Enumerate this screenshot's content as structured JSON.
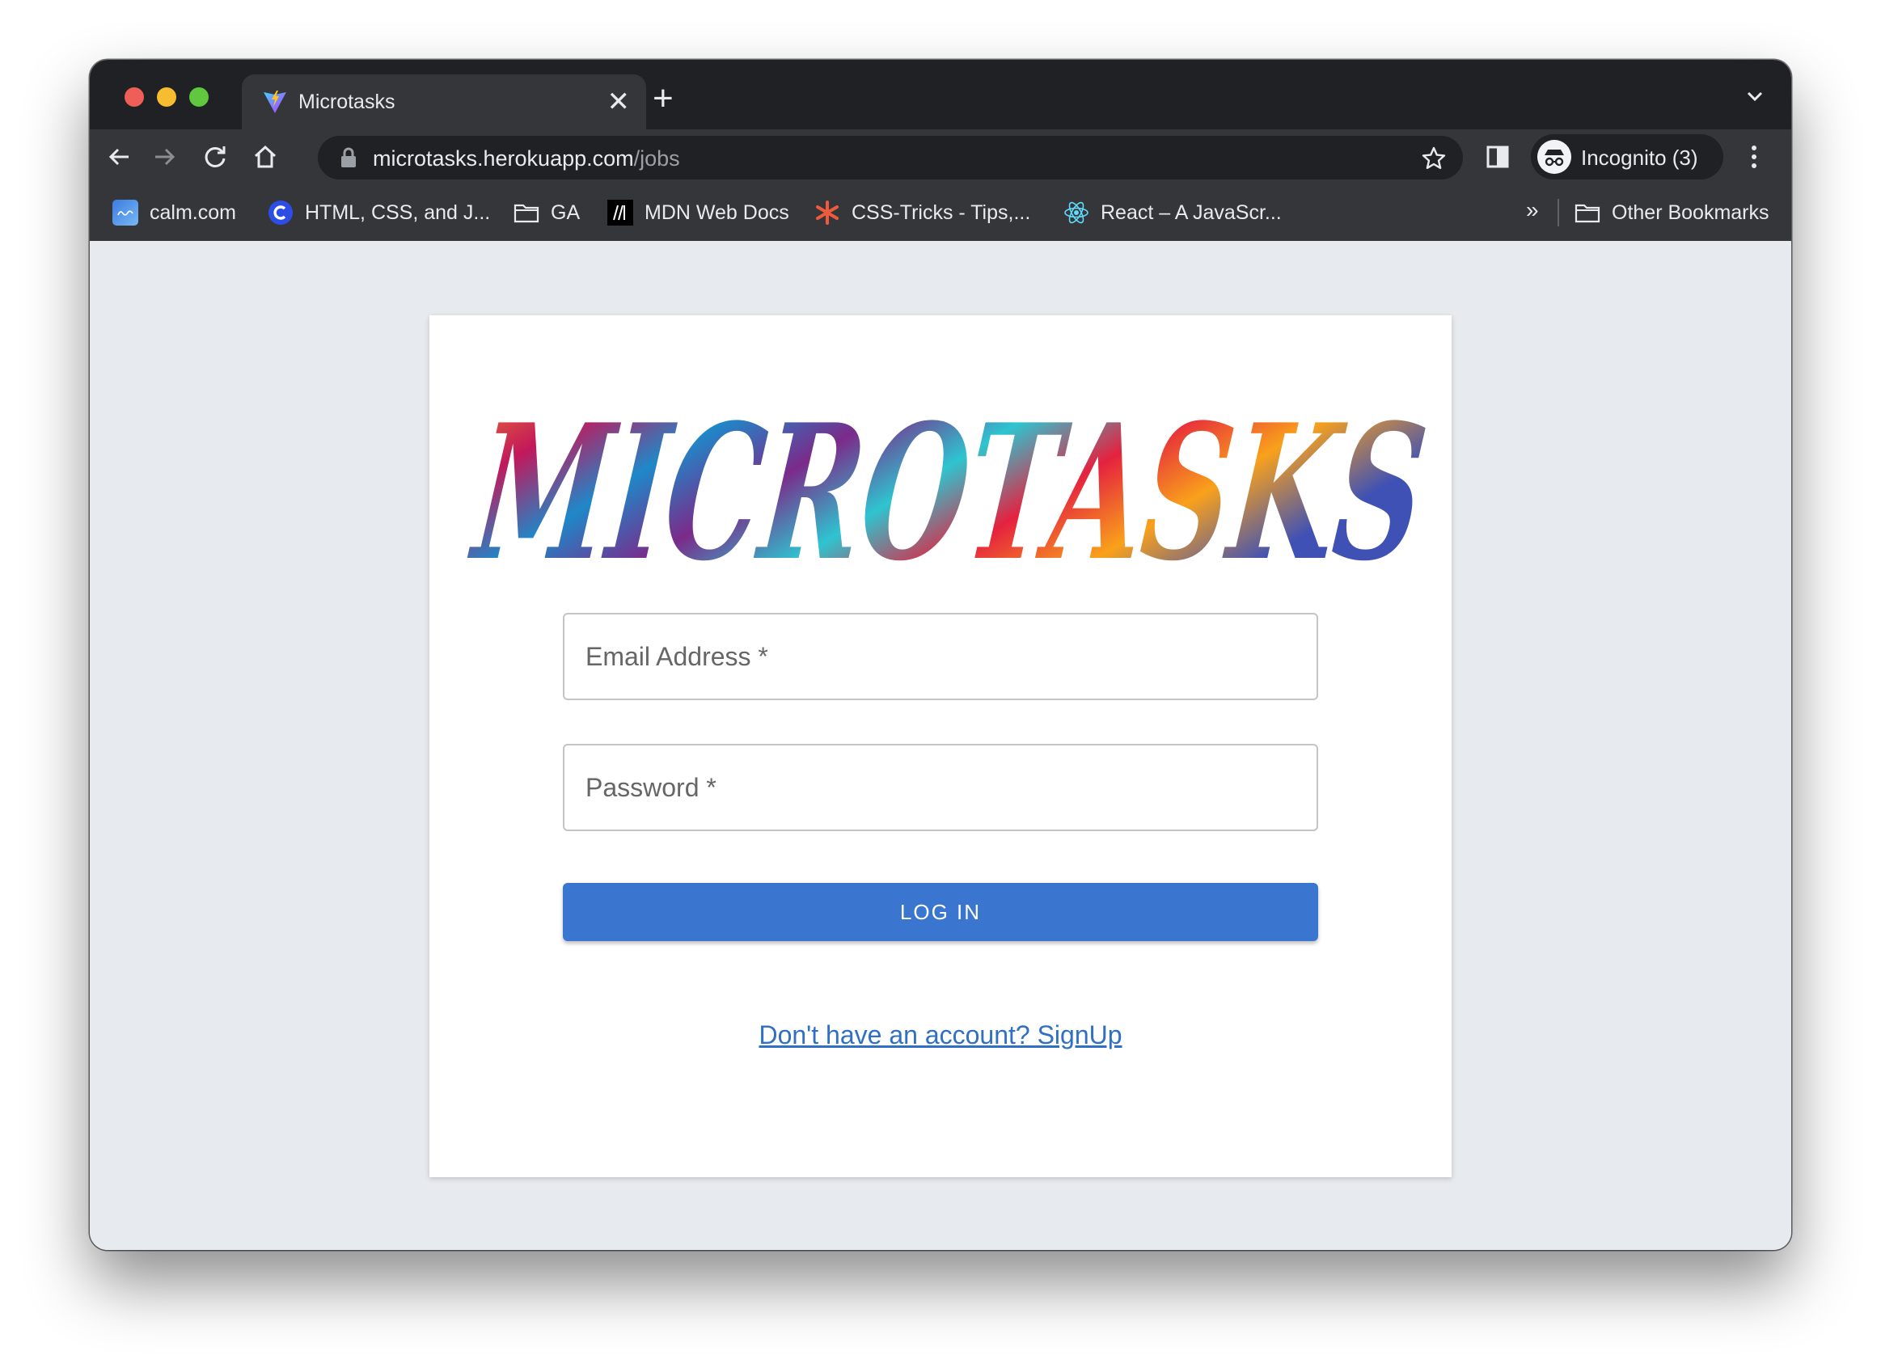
{
  "browser": {
    "tab": {
      "title": "Microtasks",
      "favicon": "vite-icon",
      "close_glyph": "✕"
    },
    "new_tab_glyph": "+",
    "address": {
      "host": "microtasks.herokuapp.com",
      "path": "/jobs"
    },
    "profile_label": "Incognito (3)",
    "bookmarks": [
      {
        "label": "calm.com",
        "icon": "calm-icon"
      },
      {
        "label": "HTML, CSS, and J...",
        "icon": "c-logo-icon"
      },
      {
        "label": "GA",
        "icon": "folder-icon"
      },
      {
        "label": "MDN Web Docs",
        "icon": "mdn-icon"
      },
      {
        "label": "CSS-Tricks - Tips,...",
        "icon": "css-tricks-icon"
      },
      {
        "label": "React – A JavaScr...",
        "icon": "react-icon"
      }
    ],
    "bookmarks_overflow": "»",
    "other_bookmarks": "Other Bookmarks"
  },
  "page": {
    "logo_text": "MICROTASKS",
    "email_placeholder": "Email Address *",
    "password_placeholder": "Password *",
    "login_label": "LOG IN",
    "signup_link": "Don't have an account? SignUp"
  },
  "colors": {
    "page_bg": "#e7eaee",
    "button": "#3a76d0",
    "link": "#2f6fc4"
  }
}
